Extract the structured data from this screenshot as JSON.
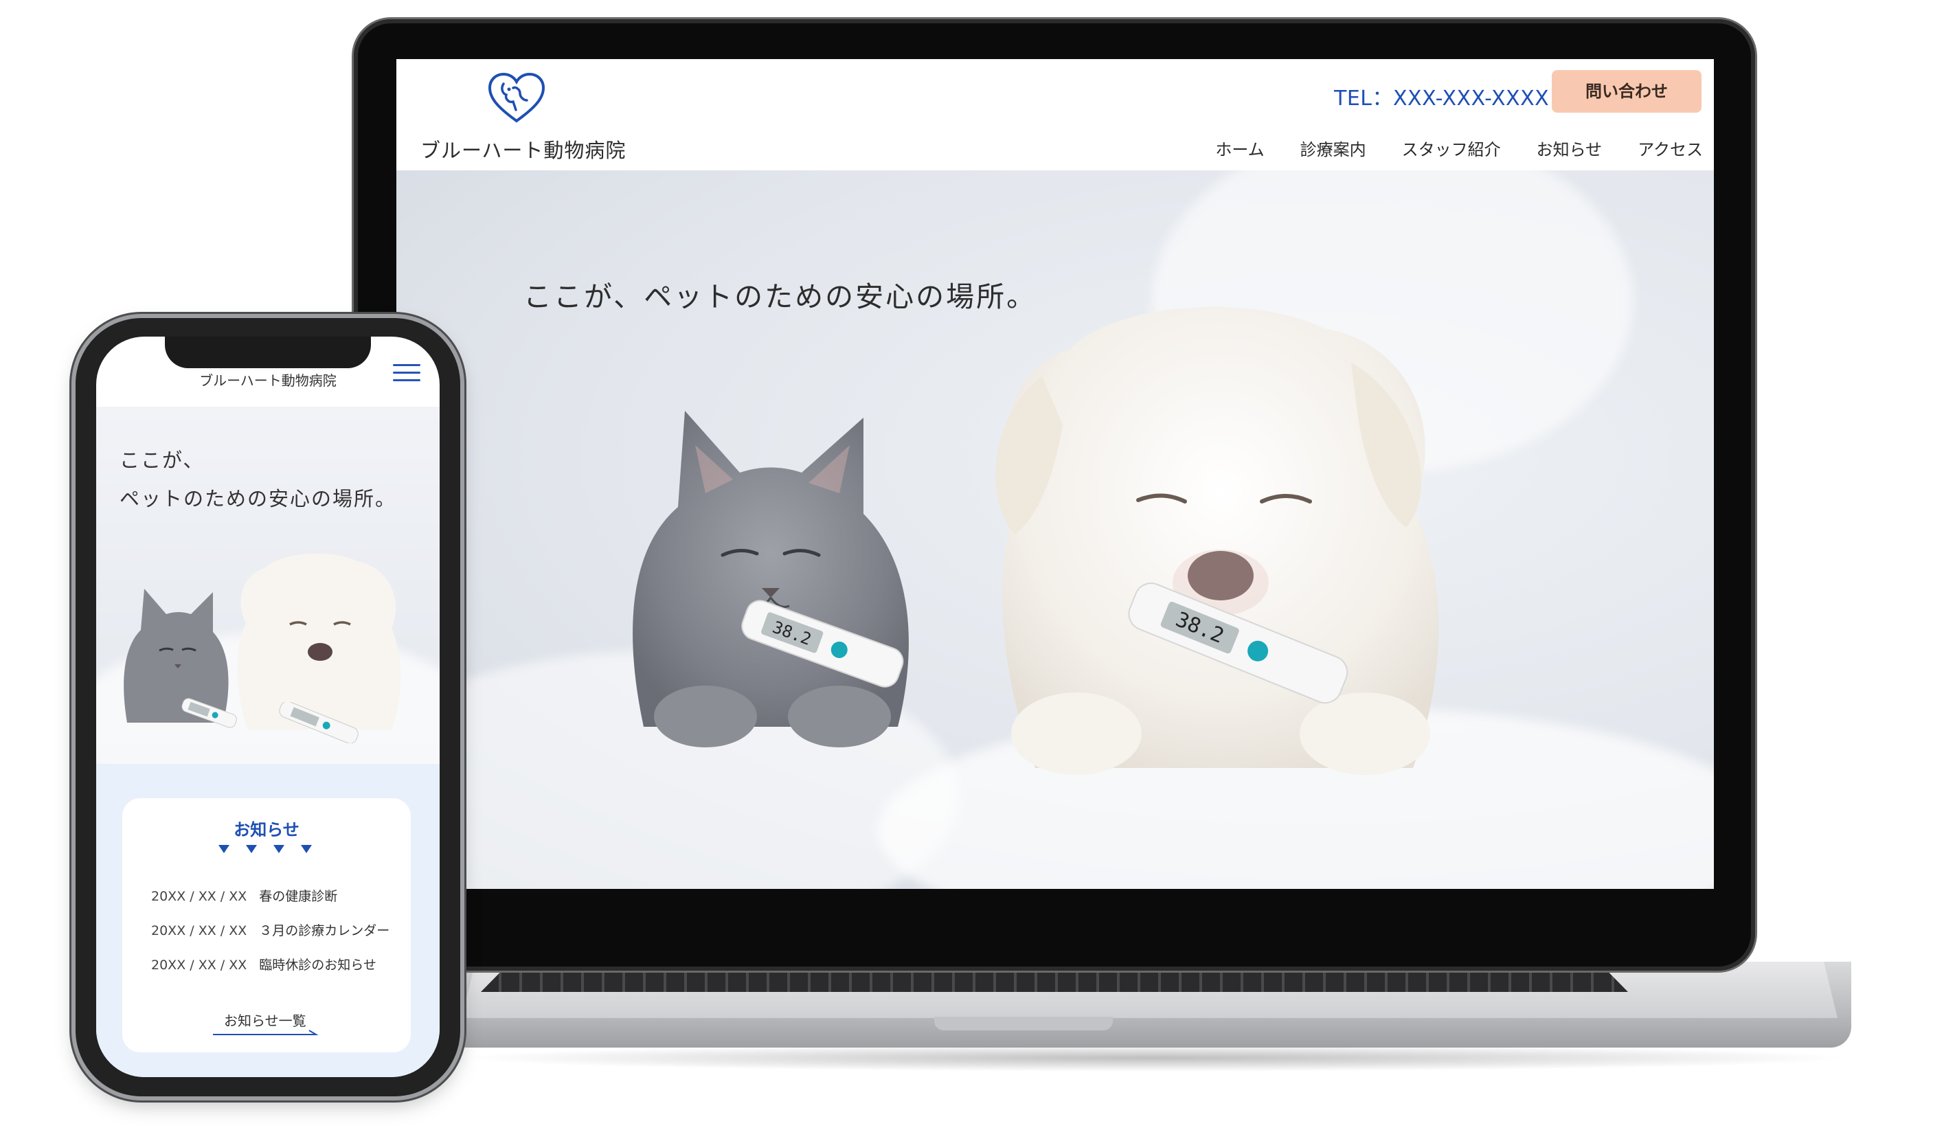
{
  "desktop": {
    "logo_text": "ブルーハート動物病院",
    "tel": "TEL：XXX-XXX-XXXX",
    "contact_button": "問い合わせ",
    "nav": [
      "ホーム",
      "診療案内",
      "スタッフ紹介",
      "お知らせ",
      "アクセス"
    ],
    "hero_tagline": "ここが、ペットのための安心の場所。",
    "thermometer_reading": "38.2"
  },
  "mobile": {
    "header_title": "ブルーハート動物病院",
    "hero_tagline_line1": "ここが、",
    "hero_tagline_line2": "ペットのための安心の場所。",
    "news": {
      "title": "お知らせ",
      "items": [
        {
          "date": "20XX / XX / XX",
          "text": "春の健康診断"
        },
        {
          "date": "20XX / XX / XX",
          "text": "３月の診療カレンダー"
        },
        {
          "date": "20XX / XX / XX",
          "text": "臨時休診のお知らせ"
        }
      ],
      "more_link": "お知らせ一覧"
    }
  },
  "colors": {
    "brand_blue": "#1e4fb3",
    "contact_button_bg": "#f8c9b0",
    "news_bg": "#e8f0fc"
  }
}
